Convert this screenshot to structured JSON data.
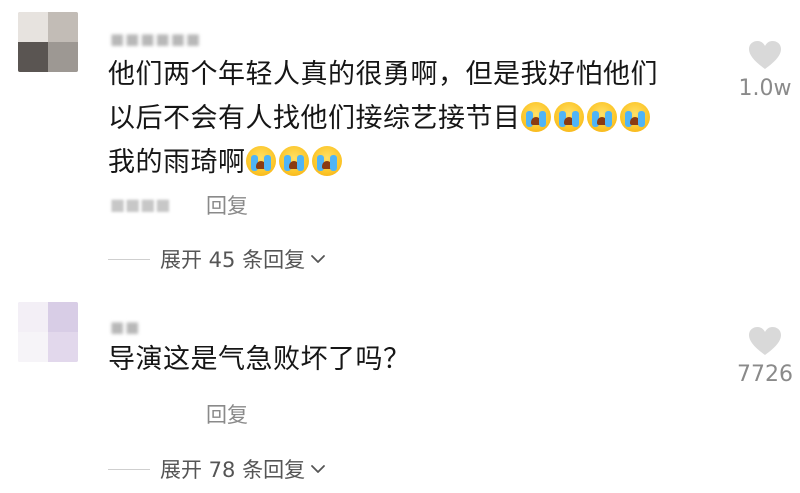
{
  "comments": [
    {
      "username": "■■■■■■",
      "text_line1": "他们两个年轻人真的很勇啊，但是我好怕他们",
      "text_line2": "以后不会有人找他们接综艺接节目",
      "text_line3": "我的雨琦啊",
      "meta": "■■■■",
      "reply_label": "回复",
      "expand_label": "展开 45 条回复",
      "like_count": "1.0w",
      "line2_emoji_count": 4,
      "line3_emoji_count": 3
    },
    {
      "username": "■■",
      "text_line1": "导演这是气急败坏了吗？",
      "meta": "",
      "reply_label": "回复",
      "expand_label": "展开 78 条回复",
      "like_count": "7726"
    }
  ],
  "icons": {
    "heart": "heart-icon",
    "emoji": "loudly-crying-face-icon",
    "chevron": "chevron-down-icon"
  },
  "colors": {
    "text": "#161616",
    "secondary": "#8a8a8a",
    "heart": "#d9d9d9"
  }
}
